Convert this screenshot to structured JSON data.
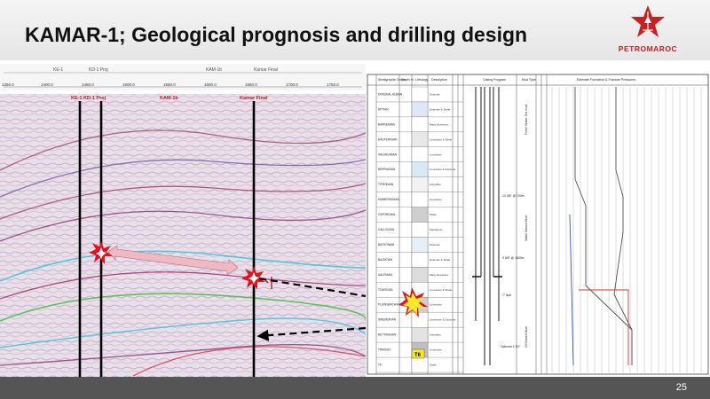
{
  "slide": {
    "title": "KAMAR-1; Geological prognosis and drilling design",
    "page_number": "25",
    "logo": {
      "text": "PETROMAROC",
      "color": "#cc1f1f",
      "icon": "star-derrick-logo"
    }
  },
  "seismic": {
    "ruler_labels": [
      "KE-1",
      "KD-1 Proj",
      "KAM-1b",
      "Kamar Final"
    ],
    "axis_ticks": [
      "1350.0",
      "1400.0",
      "1450.0",
      "1500.0",
      "1550.0",
      "1600.0",
      "1650.0",
      "1700.0",
      "1750.0",
      "1800.0"
    ],
    "well_labels": [
      "KE-1 KD-1 Proj",
      "KAM-1b",
      "Kamar Final"
    ],
    "colors": {
      "well_line": "#000000",
      "burst_red": "#e0141e",
      "arrow_pink": "#f2b8c2",
      "horizon_green": "#3fbf3f",
      "horizon_cyan": "#39c6d6"
    }
  },
  "prognosis": {
    "headers": {
      "strat": "Stratigraphic Series",
      "depth": "Depth m",
      "lithology": "Lithology",
      "description": "Description",
      "casing": "Casing Program",
      "mud": "Mud Type",
      "formation": "Estimate Formation & Fracture Pressures"
    },
    "formations": [
      "ORIGINAL ALBIAN",
      "APTIAN",
      "BARREMIAN",
      "HAUTERIVIAN",
      "VALANGINIAN",
      "BERRIASIAN",
      "TITHONIAN",
      "KIMMERIDGIAN",
      "OXFORDIAN",
      "CALLOVIAN",
      "BATHONIAN",
      "BAJOCIAN",
      "AALENIAN",
      "TOARCIAN",
      "PLIENSBACHIAN",
      "SINEMURIAN",
      "HETTANGIAN",
      "TRIASSIC",
      "TD"
    ],
    "descriptions": [
      "Dolomite",
      "Dolomite & Shale",
      "Marly limestone",
      "Limestone & Shale",
      "Limestone",
      "Limestone & Dolomite",
      "Anhydrite",
      "Limestone",
      "Shale",
      "Sandstone"
    ],
    "casing_labels": [
      "13 3/8\" @ 700m",
      "9 5/8\" @ 1800m",
      "7\" liner",
      "Optional 4 1/2\"",
      "T6"
    ],
    "mud_labels": [
      "Fresh Water Gel mud",
      "Water Based Mud",
      "Oil Based Mud"
    ]
  }
}
